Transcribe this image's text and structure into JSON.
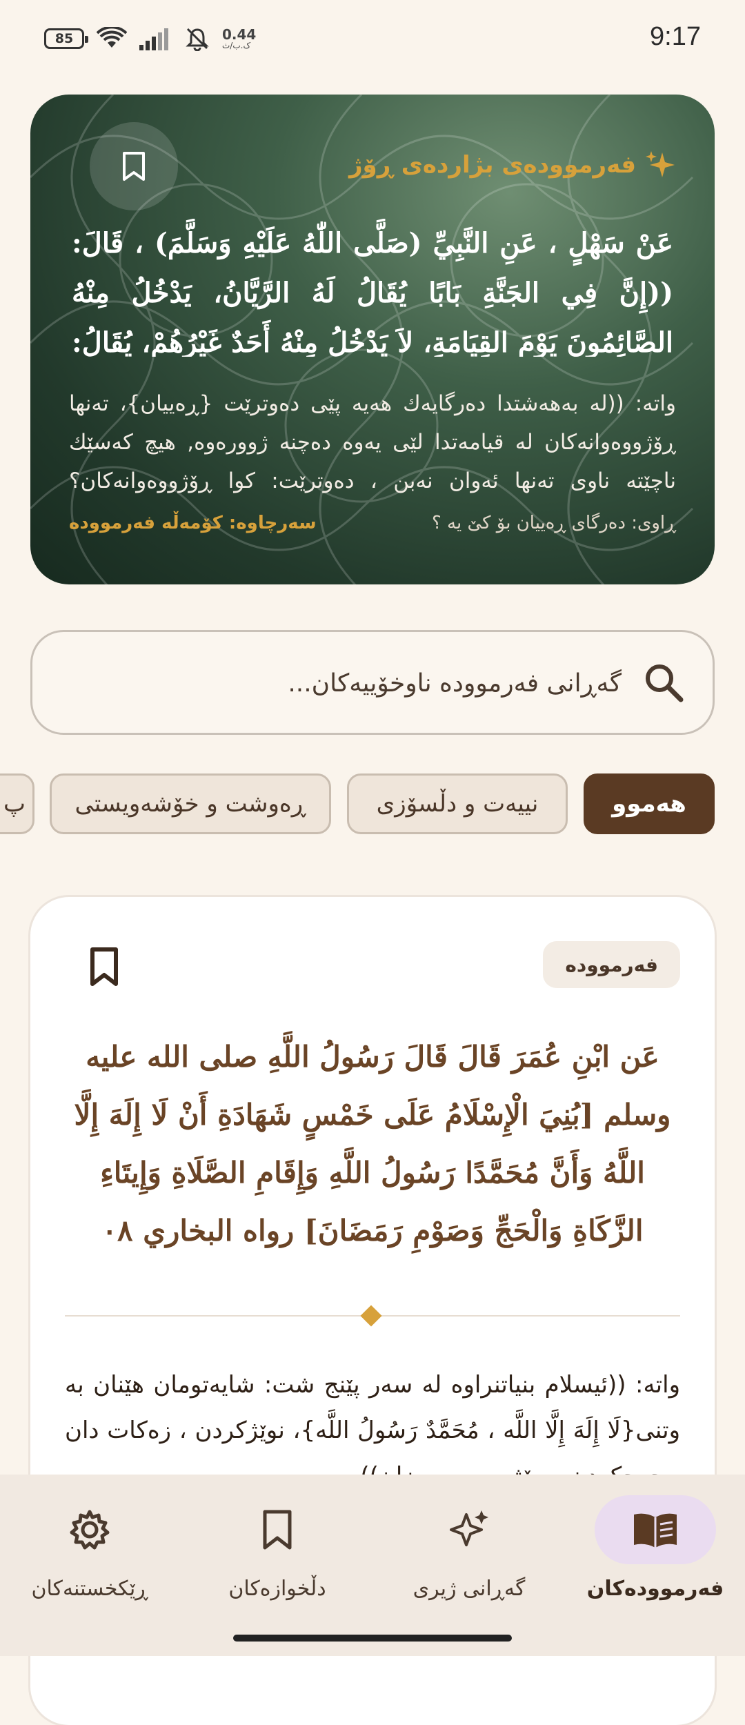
{
  "status_bar": {
    "battery": "85",
    "net_speed_value": "0.44",
    "net_speed_unit": "ک.ب/ث",
    "time": "9:17",
    "icons": [
      "battery-icon",
      "wifi-icon",
      "signal-icon",
      "mute-icon"
    ]
  },
  "hero": {
    "title": "فەرموودەی بژاردەی ڕۆژ",
    "arabic": "عَنْ سَهْلٍ ، عَنِ النَّبِيِّ (صَلَّى اللّٰهُ عَلَيْهِ وَسَلَّمَ) ، قَالَ: ((إِنَّ فِي الجَنَّةِ بَابًا يُقَالُ لَهُ الرَّيَّانُ، يَدْخُلُ مِنْهُ الصَّائِمُونَ يَوْمَ القِيَامَةِ، لاَ يَدْخُلُ مِنْهُ أَحَدٌ غَيْرُهُمْ، يُقَالُ: أَيْنَ الصَّائِمُونَ؟ فَيَقُومُونَ لاَ يَدْخُلُ مِنْهُ أَحَدٌ",
    "translation": "واتە: ((لە بەهەشتدا دەرگایەك هەیە پێی دەوترێت {ڕەییان}، تەنها ڕۆژووەوانەکان لە قیامەتدا لێی یەوە دەچنە ژوورەوە, هیچ کەسێك ناچێتە ناوی تەنها ئەوان نەبن ، دەوترێت: کوا ڕۆژووەوانەکان؟ ئەوانیش",
    "narrator": "ڕاوی: دەرگای ڕەییان بۆ کێ یە ؟",
    "source": "سەرچاوە: کۆمەڵە فەرموودە",
    "colors": {
      "accent": "#d7a13b",
      "background": "#2f4b39"
    }
  },
  "search": {
    "placeholder": "گەڕانی فەرموودە ناوخۆییەکان...",
    "value": ""
  },
  "chips": {
    "items": [
      {
        "label": "هەموو",
        "active": true
      },
      {
        "label": "نییەت و دڵسۆزی",
        "active": false
      },
      {
        "label": "ڕەوشت و خۆشەویستی",
        "active": false
      },
      {
        "label": "پ",
        "active": false
      }
    ]
  },
  "card": {
    "badge": "فەرموودە",
    "arabic": "عَن ابْنِ عُمَرَ قَالَ قَالَ رَسُولُ اللَّهِ صلى الله عليه وسلم [بُنِيَ الْإِسْلَامُ عَلَى خَمْسٍ شَهَادَةِ أَنْ لَا إِلَهَ إِلَّا اللَّهُ وَأَنَّ مُحَمَّدًا رَسُولُ اللَّهِ وَإِقَامِ الصَّلَاةِ وَإِيتَاءِ الزَّكَاةِ وَالْحَجِّ وَصَوْمِ رَمَضَانَ] رواه البخاري ٠٨",
    "translation": "واتە: ((ئیسلام بنیاتنراوە لە سەر پێنج شت: شایەتومان هێنان بە وتنی{لَا إِلَهَ إِلَّا اللَّه ، مُحَمَّدٌ رَسُولُ اللَّه}، نوێژکردن ، زەکات دان ، حەجکردن ، ڕۆژوو ، ڕەمەزان))"
  },
  "bottom_nav": {
    "items": [
      {
        "label": "فەرموودەکان",
        "icon": "book-icon",
        "active": true
      },
      {
        "label": "گەڕانی ژیری",
        "icon": "sparkle-icon",
        "active": false
      },
      {
        "label": "دڵخوازەکان",
        "icon": "bookmark-icon",
        "active": false
      },
      {
        "label": "ڕێکخستنەکان",
        "icon": "gear-icon",
        "active": false
      }
    ],
    "active_pill_color": "#eadcf0"
  }
}
